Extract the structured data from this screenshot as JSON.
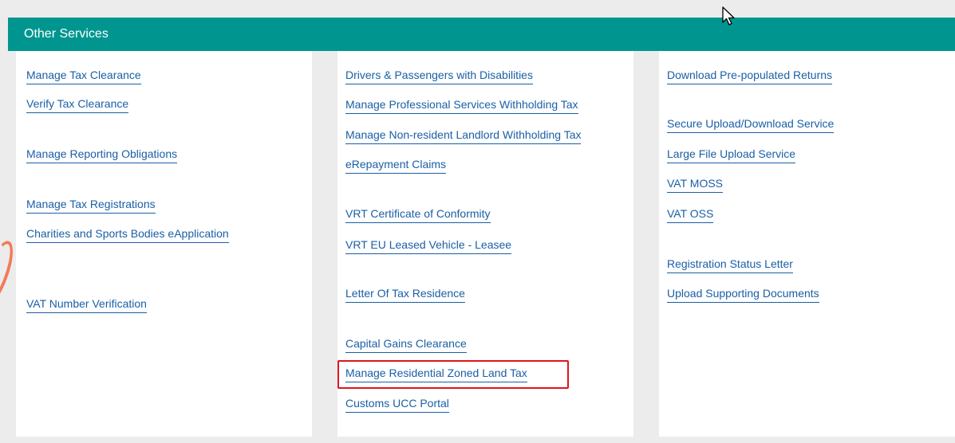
{
  "header": {
    "title": "Other Services"
  },
  "columns": [
    {
      "links": [
        "Manage Tax Clearance",
        "Verify Tax Clearance",
        "Manage Reporting Obligations",
        "Manage Tax Registrations",
        "Charities and Sports Bodies eApplication",
        "VAT Number Verification"
      ]
    },
    {
      "links": [
        "Drivers & Passengers with Disabilities",
        "Manage Professional Services Withholding Tax",
        "Manage Non-resident Landlord Withholding Tax",
        "eRepayment Claims",
        "VRT Certificate of Conformity",
        "VRT EU Leased Vehicle - Leasee",
        "Letter Of Tax Residence",
        "Capital Gains Clearance",
        "Manage Residential Zoned Land Tax",
        "Customs UCC Portal"
      ]
    },
    {
      "links": [
        "Download Pre-populated Returns",
        "Secure Upload/Download Service",
        "Large File Upload Service",
        "VAT MOSS",
        "VAT OSS",
        "Registration Status Letter",
        "Upload Supporting Documents"
      ]
    }
  ],
  "highlighted_link": "Manage Residential Zoned Land Tax",
  "colors": {
    "header_bg": "#00968f",
    "link": "#1a5fa6",
    "highlight_border": "#e0141e"
  }
}
